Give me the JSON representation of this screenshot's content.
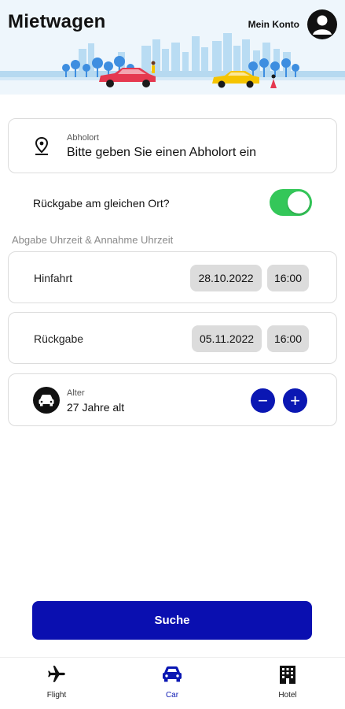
{
  "header": {
    "title": "Mietwagen",
    "account_label": "Mein Konto",
    "accent_color": "#f5c400"
  },
  "pickup": {
    "label": "Abholort",
    "placeholder": "Bitte geben Sie einen Abholort ein"
  },
  "same_place": {
    "label": "Rückgabe am gleichen Ort?",
    "enabled": true,
    "color": "#34c759"
  },
  "schedule": {
    "section_label": "Abgabe Uhrzeit & Annahme Uhrzeit",
    "departure": {
      "label": "Hinfahrt",
      "date": "28.10.2022",
      "time": "16:00"
    },
    "return": {
      "label": "Rückgabe",
      "date": "05.11.2022",
      "time": "16:00"
    }
  },
  "age": {
    "label": "Alter",
    "value": "27 Jahre alt",
    "decrement_symbol": "−",
    "increment_symbol": "+"
  },
  "search": {
    "label": "Suche",
    "color": "#0a0fb0"
  },
  "nav": {
    "items": [
      {
        "label": "Flight",
        "icon": "airplane-icon"
      },
      {
        "label": "Car",
        "icon": "car-icon",
        "active": true
      },
      {
        "label": "Hotel",
        "icon": "hotel-icon"
      }
    ],
    "active_color": "#0a17b3"
  }
}
